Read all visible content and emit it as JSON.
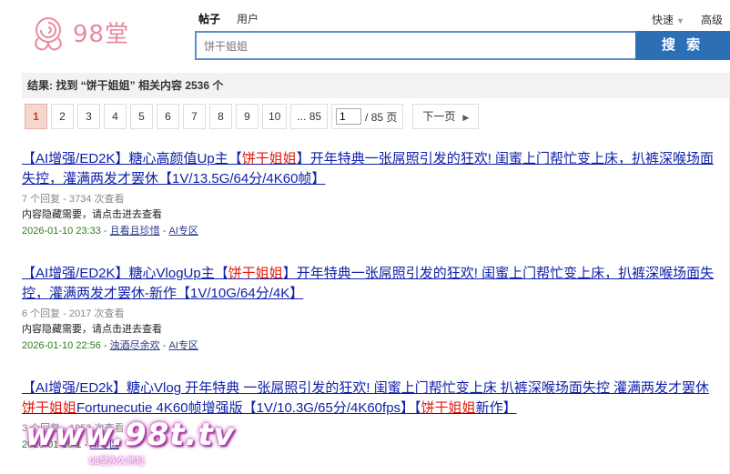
{
  "header": {
    "logo_text": "98堂",
    "tabs": [
      {
        "label": "帖子",
        "active": true
      },
      {
        "label": "用户",
        "active": false
      }
    ],
    "search_value": "饼干姐姐",
    "search_button": "搜 索",
    "links": {
      "quick": "快速",
      "advanced": "高级"
    }
  },
  "result_summary": "结果: 找到 “饼干姐姐” 相关内容 2536 个",
  "pagination": {
    "pages": [
      "1",
      "2",
      "3",
      "4",
      "5",
      "6",
      "7",
      "8",
      "9",
      "10",
      "... 85"
    ],
    "current": "1",
    "input_value": "1",
    "total": "/ 85 页",
    "next": "下一页"
  },
  "results": [
    {
      "title_parts": [
        "【AI增强/ED2K】糖心高颜值Up主【",
        "饼干姐姐",
        "】开年特典一张屌照引发的狂欢! 闺蜜上门帮忙变上床，扒裤深喉场面失控，灌满两发才罢休【1V/13.5G/64分/4K60帧】"
      ],
      "meta": "7 个回复 - 3734 次查看",
      "desc": "内容隐藏需要，请点击进去查看",
      "date": "2026-01-10 23:33",
      "author": "且看且珍惜",
      "forum": "AI专区"
    },
    {
      "title_parts": [
        "【AI增强/ED2K】糖心VlogUp主【",
        "饼干姐姐",
        "】开年特典一张屌照引发的狂欢! 闺蜜上门帮忙变上床，扒裤深喉场面失控，灌满两发才罢休-新作【1V/10G/64分/4K】"
      ],
      "meta": "6 个回复 - 2017 次查看",
      "desc": "内容隐藏需要，请点击进去查看",
      "date": "2026-01-10 22:56",
      "author": "浊酒尽余欢",
      "forum": "AI专区"
    },
    {
      "title_parts": [
        "【AI增强/ED2k】糖心Vlog 开年特典 一张屌照引发的狂欢! 闺蜜上门帮忙变上床 扒裤深喉场面失控 灌满两发才罢休 ",
        "饼干姐姐",
        "Fortunecutie 4K60帧增强版【1V/10.3G/65分/4K60fps】【",
        "饼干姐姐",
        "新作】"
      ],
      "meta": "3 个回复 - 1953 次查看",
      "desc": "",
      "date": "2026-01-10 1",
      "author": "",
      "forum": "AI专区"
    }
  ],
  "watermark": {
    "main": "www.98t.tv",
    "sub": "98堂永久地址"
  },
  "colors": {
    "link": "#1122aa",
    "highlight": "#e0190a",
    "date": "#2e7d1e",
    "search_button": "#2c6fb5",
    "current_page_bg": "#f6d7d0"
  }
}
